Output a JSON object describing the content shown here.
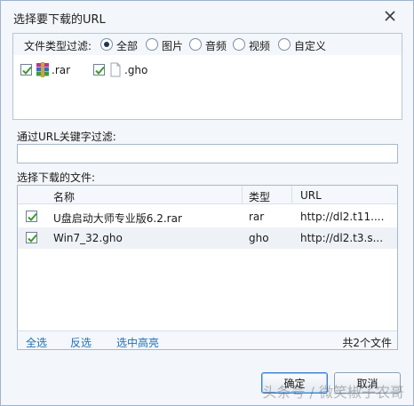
{
  "window": {
    "title": "选择要下载的URL"
  },
  "filter": {
    "label": "文件类型过滤:",
    "options": [
      {
        "label": "全部",
        "checked": true
      },
      {
        "label": "图片",
        "checked": false
      },
      {
        "label": "音频",
        "checked": false
      },
      {
        "label": "视频",
        "checked": false
      },
      {
        "label": "自定义",
        "checked": false
      }
    ],
    "extensions": [
      {
        "label": ".rar",
        "checked": true,
        "icon": "winrar-archive-icon"
      },
      {
        "label": ".gho",
        "checked": true,
        "icon": "blank-file-icon"
      }
    ]
  },
  "keyword": {
    "label": "通过URL关键字过滤:",
    "value": ""
  },
  "files": {
    "label": "选择下载的文件:",
    "columns": {
      "name": "名称",
      "type": "类型",
      "url": "URL"
    },
    "rows": [
      {
        "checked": true,
        "name": "U盘启动大师专业版6.2.rar",
        "type": "rar",
        "url": "http://dl2.t11...."
      },
      {
        "checked": true,
        "name": "Win7_32.gho",
        "type": "gho",
        "url": "http://dl2.t3.s..."
      }
    ],
    "footer": {
      "select_all": "全选",
      "invert": "反选",
      "select_highlighted": "选中高亮",
      "count": "共2个文件"
    }
  },
  "buttons": {
    "ok": "确定",
    "cancel": "取消"
  },
  "watermark": "头条号 / 微笑椒子农哥",
  "colors": {
    "accent": "#1e6fb8",
    "check": "#3c9a2e",
    "border": "#a9b8c9"
  }
}
